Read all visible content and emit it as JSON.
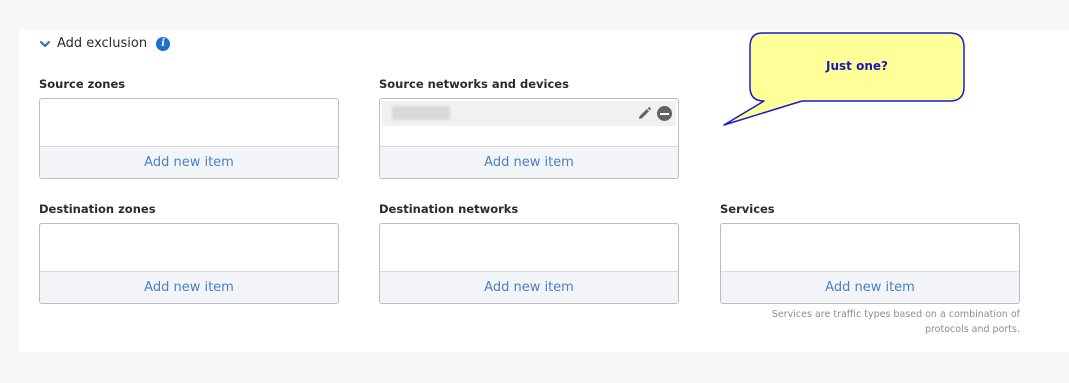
{
  "section": {
    "title": "Add exclusion",
    "info_icon": "info-icon",
    "expand_icon": "chevron-down-icon"
  },
  "fields": {
    "source_zones": {
      "label": "Source zones",
      "add_label": "Add new item"
    },
    "source_networks": {
      "label": "Source networks and devices",
      "add_label": "Add new item"
    },
    "destination_zones": {
      "label": "Destination zones",
      "add_label": "Add new item"
    },
    "destination_networks": {
      "label": "Destination networks",
      "add_label": "Add new item"
    },
    "services": {
      "label": "Services",
      "add_label": "Add new item",
      "hint_line1": "Services are traffic types based on a combination of",
      "hint_line2": "protocols and ports."
    }
  },
  "callout": {
    "text": "Just one?"
  },
  "colors": {
    "accent": "#4a7fc9",
    "info": "#1f6fd1",
    "callout_fill": "#ffff99",
    "callout_border": "#1a1acc"
  }
}
